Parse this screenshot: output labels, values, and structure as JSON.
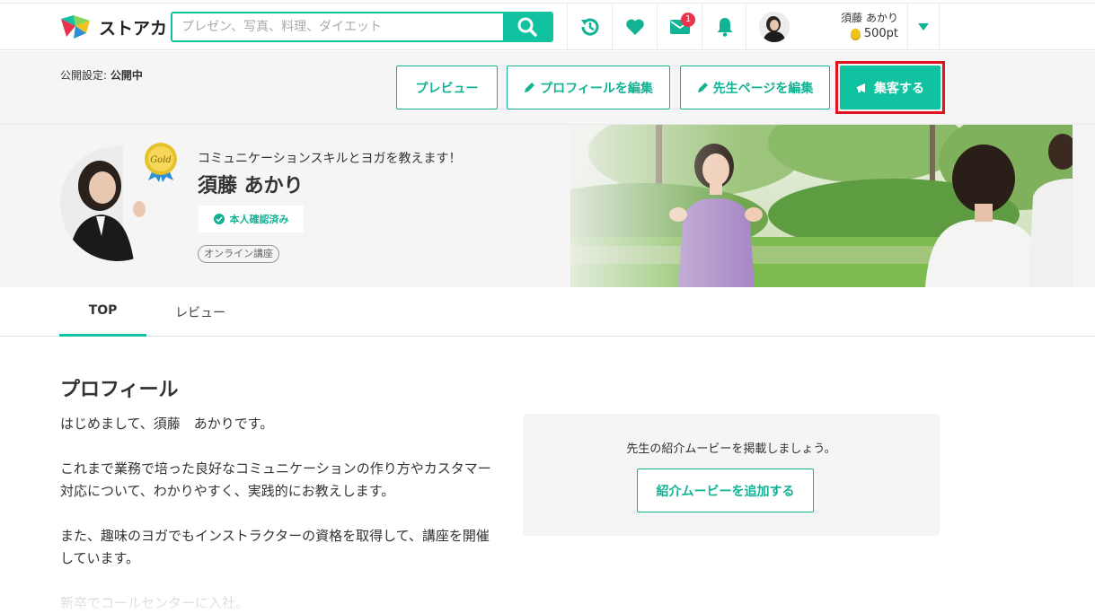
{
  "header": {
    "logo_text": "ストアカ",
    "search_placeholder": "プレゼン、写真、料理、ダイエット",
    "message_count": "1",
    "user_name": "須藤 あかり",
    "points": "500pt",
    "icons": [
      "history-icon",
      "heart-icon",
      "mail-icon",
      "bell-icon",
      "chevron-down-icon",
      "search-icon"
    ]
  },
  "adminbar": {
    "publish_label": "公開設定: ",
    "publish_status": "公開中",
    "buttons": {
      "preview": "プレビュー",
      "edit_profile": "プロフィールを編集",
      "edit_teacher_page": "先生ページを編集",
      "promote": "集客する"
    }
  },
  "profile": {
    "catchphrase": "コミュニケーションスキルとヨガを教えます！",
    "name": "須藤 あかり",
    "badge_text": "Gold",
    "verified": "本人確認済み",
    "tag": "オンライン講座"
  },
  "tabs": [
    {
      "label": "TOP",
      "active": true
    },
    {
      "label": "レビュー",
      "active": false
    }
  ],
  "content": {
    "heading": "プロフィール",
    "paragraphs": [
      "はじめまして、須藤　あかりです。",
      "これまで業務で培った良好なコミュニケーションの作り方やカスタマー対応について、わかりやすく、実践的にお教えします。",
      "また、趣味のヨガでもインストラクターの資格を取得して、講座を開催しています。",
      "新卒でコールセンターに入社。"
    ],
    "movie": {
      "prompt": "先生の紹介ムービーを掲載しましょう。",
      "button": "紹介ムービーを追加する"
    }
  },
  "colors": {
    "accent": "#11c2a0",
    "badge": "#e8344e",
    "highlight": "#e0141e"
  }
}
